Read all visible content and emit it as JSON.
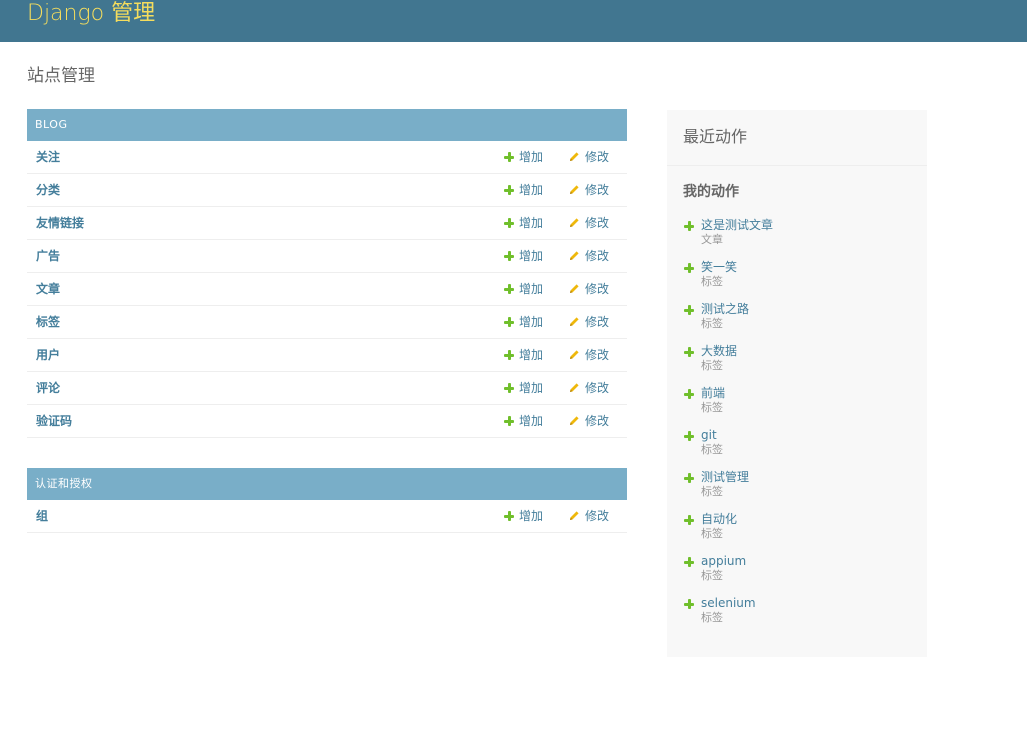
{
  "header": {
    "site_name": "Django 管理"
  },
  "page": {
    "title": "站点管理"
  },
  "modules": [
    {
      "caption": "BLOG",
      "rows": [
        {
          "name": "关注",
          "add": "增加",
          "change": "修改"
        },
        {
          "name": "分类",
          "add": "增加",
          "change": "修改"
        },
        {
          "name": "友情链接",
          "add": "增加",
          "change": "修改"
        },
        {
          "name": "广告",
          "add": "增加",
          "change": "修改"
        },
        {
          "name": "文章",
          "add": "增加",
          "change": "修改"
        },
        {
          "name": "标签",
          "add": "增加",
          "change": "修改"
        },
        {
          "name": "用户",
          "add": "增加",
          "change": "修改"
        },
        {
          "name": "评论",
          "add": "增加",
          "change": "修改"
        },
        {
          "name": "验证码",
          "add": "增加",
          "change": "修改"
        }
      ]
    },
    {
      "caption": "认证和授权",
      "rows": [
        {
          "name": "组",
          "add": "增加",
          "change": "修改"
        }
      ]
    }
  ],
  "recent_actions": {
    "title": "最近动作",
    "subtitle": "我的动作",
    "items": [
      {
        "label": "这是测试文章",
        "type": "文章"
      },
      {
        "label": "笑一笑",
        "type": "标签"
      },
      {
        "label": "测试之路",
        "type": "标签"
      },
      {
        "label": "大数据",
        "type": "标签"
      },
      {
        "label": "前端",
        "type": "标签"
      },
      {
        "label": "git",
        "type": "标签"
      },
      {
        "label": "测试管理",
        "type": "标签"
      },
      {
        "label": "自动化",
        "type": "标签"
      },
      {
        "label": "appium",
        "type": "标签"
      },
      {
        "label": "selenium",
        "type": "标签"
      }
    ]
  },
  "colors": {
    "header_bg": "#417690",
    "brand": "#f5dd5d",
    "caption_bg": "#79aec8",
    "link": "#447e9b",
    "add_icon": "#70bf2b",
    "change_icon": "#efb80b"
  },
  "icons": {
    "add": "plus-icon",
    "change": "pencil-icon"
  }
}
